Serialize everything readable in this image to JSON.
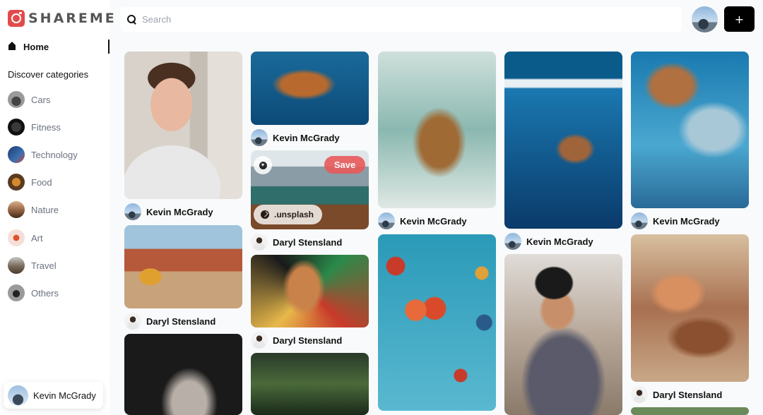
{
  "app": {
    "logo_text": "SHAREME"
  },
  "sidebar": {
    "home_label": "Home",
    "discover_title": "Discover categories",
    "categories": [
      {
        "label": "Cars",
        "icon": "car-thumbnail"
      },
      {
        "label": "Fitness",
        "icon": "fitness-thumbnail"
      },
      {
        "label": "Technology",
        "icon": "technology-thumbnail"
      },
      {
        "label": "Food",
        "icon": "food-thumbnail"
      },
      {
        "label": "Nature",
        "icon": "nature-thumbnail"
      },
      {
        "label": "Art",
        "icon": "art-thumbnail"
      },
      {
        "label": "Travel",
        "icon": "travel-thumbnail"
      },
      {
        "label": "Others",
        "icon": "others-thumbnail"
      }
    ],
    "user": {
      "name": "Kevin McGrady"
    }
  },
  "header": {
    "search_placeholder": "Search",
    "add_label": "+"
  },
  "pins": [
    {
      "author": "Kevin McGrady",
      "subject": "man portrait"
    },
    {
      "author": "Daryl Stensland",
      "subject": "van on desert road"
    },
    {
      "author": "Daryl Stensland",
      "subject": "statue"
    },
    {
      "author": "Kevin McGrady",
      "subject": "sea turtle"
    },
    {
      "author": "Daryl Stensland",
      "subject": "boat on lake"
    },
    {
      "author": "Daryl Stensland",
      "subject": "graffiti mural"
    },
    {
      "author": "",
      "subject": "forest bridge"
    },
    {
      "author": "Kevin McGrady",
      "subject": "sea turtle"
    },
    {
      "author": "",
      "subject": "hot air balloons"
    },
    {
      "author": "Kevin McGrady",
      "subject": "turtle underwater"
    },
    {
      "author": "",
      "subject": "photographer"
    },
    {
      "author": "Kevin McGrady",
      "subject": "sea turtle close"
    },
    {
      "author": "Daryl Stensland",
      "subject": "ceiling painting"
    }
  ],
  "hover_overlay": {
    "save_label": "Save",
    "source_label": ".unsplash"
  },
  "colors": {
    "accent": "#e95a5a",
    "logo": "#e34b4b",
    "button": "#000000"
  }
}
